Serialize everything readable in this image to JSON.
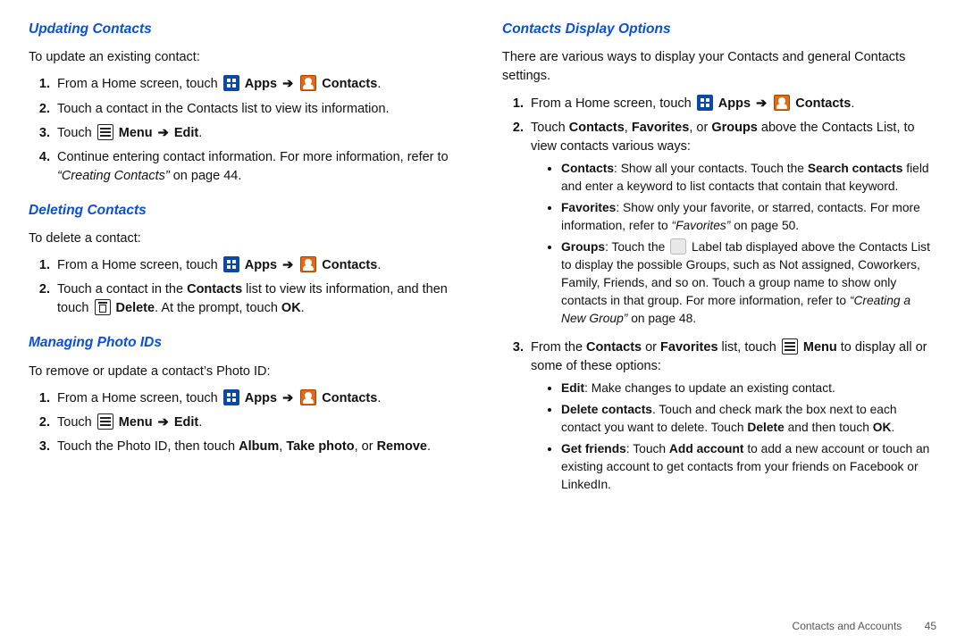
{
  "left": {
    "updating": {
      "title": "Updating Contacts",
      "lead": "To update an existing contact:",
      "s1a": "From a Home screen, touch ",
      "apps": "Apps",
      "contacts": "Contacts",
      "period": ".",
      "s2": "Touch a contact in the Contacts list to view its information.",
      "s3a": "Touch ",
      "menu": "Menu",
      "edit": "Edit",
      "s4a": "Continue entering contact information. For more information, refer to ",
      "s4ref": "“Creating Contacts”",
      "s4b": "  on page 44."
    },
    "deleting": {
      "title": "Deleting Contacts",
      "lead": "To delete a contact:",
      "s1a": "From a Home screen, touch ",
      "apps": "Apps",
      "contacts": "Contacts",
      "period": ".",
      "s2a": "Touch a contact in the ",
      "s2b": "Contacts",
      "s2c": " list to view its information, and then touch ",
      "s2d": "Delete",
      "s2e": ". At the prompt, touch ",
      "s2f": "OK",
      "s2g": "."
    },
    "photoids": {
      "title": "Managing Photo IDs",
      "lead": "To remove or update a contact’s Photo ID:",
      "s1a": "From a Home screen, touch ",
      "apps": "Apps",
      "contacts": "Contacts",
      "period": ".",
      "s2a": "Touch ",
      "menu": "Menu",
      "edit": "Edit",
      "s3a": "Touch the Photo ID, then touch ",
      "s3b": "Album",
      "s3c": ", ",
      "s3d": "Take photo",
      "s3e": ", or ",
      "s3f": "Remove",
      "s3g": "."
    }
  },
  "right": {
    "display": {
      "title": "Contacts Display Options",
      "lead": "There are various ways to display your Contacts and general Contacts settings.",
      "s1a": "From a Home screen, touch ",
      "apps": "Apps",
      "contacts": "Contacts",
      "period": ".",
      "s2a": "Touch ",
      "s2b": "Contacts",
      "s2c": ", ",
      "s2d": "Favorites",
      "s2e": ", or ",
      "s2f": "Groups",
      "s2g": " above the Contacts List, to view contacts various ways:",
      "b1a": "Contacts",
      "b1b": ": Show all your contacts. Touch the ",
      "b1c": "Search contacts",
      "b1d": " field and enter a keyword to list contacts that contain that keyword.",
      "b2a": "Favorites",
      "b2b": ": Show only your favorite, or starred, contacts. For more information, refer to ",
      "b2c": "“Favorites”",
      "b2d": "  on page 50.",
      "b3a": "Groups",
      "b3b": ": Touch the ",
      "b3c": " Label tab displayed above the Contacts List to display the possible Groups, such as Not assigned, Coworkers, Family, Friends, and so on. Touch a group name to show only contacts in that group. For more information, refer to ",
      "b3d": "“Creating a New Group”",
      "b3e": "  on page 48.",
      "s3a": "From the ",
      "s3b": "Contacts",
      "s3c": " or ",
      "s3d": "Favorites",
      "s3e": " list, touch ",
      "menu": "Menu",
      "s3f": " to display all or some of these options:",
      "e1a": "Edit",
      "e1b": ": Make changes to update an existing contact.",
      "e2a": "Delete contacts",
      "e2b": ". Touch and check mark the box next to each contact you want to delete. Touch ",
      "e2c": "Delete",
      "e2d": " and then touch ",
      "e2e": "OK",
      "e2f": ".",
      "e3a": "Get friends",
      "e3b": ": Touch ",
      "e3c": "Add account",
      "e3d": " to add a new account or touch an existing account to get contacts from your friends on Facebook or LinkedIn."
    }
  },
  "footer": {
    "section": "Contacts and Accounts",
    "page": "45"
  },
  "glyph": {
    "arrow": "➔"
  }
}
